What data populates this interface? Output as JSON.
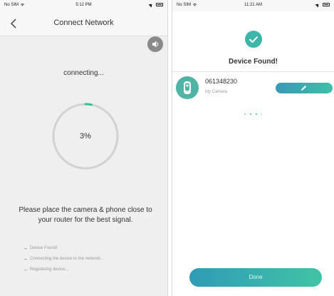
{
  "left": {
    "status": {
      "carrier": "No SIM",
      "time": "5:12 PM"
    },
    "nav": {
      "title": "Connect Network"
    },
    "connecting_text": "connecting...",
    "progress": {
      "percent": 3,
      "label": "3%"
    },
    "tip": "Please place the camera & phone close to your router for the best signal.",
    "steps": [
      "Device Found!",
      "Connecting the device to the network...",
      "Registering device..."
    ]
  },
  "right": {
    "status": {
      "carrier": "No SIM",
      "time": "11:21 AM"
    },
    "title": "Device Found!",
    "device": {
      "id": "061348230",
      "name": "My Camera"
    },
    "done_label": "Done"
  },
  "colors": {
    "accent": "#3cb6a8",
    "progress_track": "#d2d2d2",
    "progress_fill": "#3cbf8f"
  },
  "icons": [
    "back-chevron-icon",
    "sound-icon",
    "check-icon",
    "camera-icon",
    "edit-icon",
    "wifi-icon",
    "battery-icon"
  ]
}
